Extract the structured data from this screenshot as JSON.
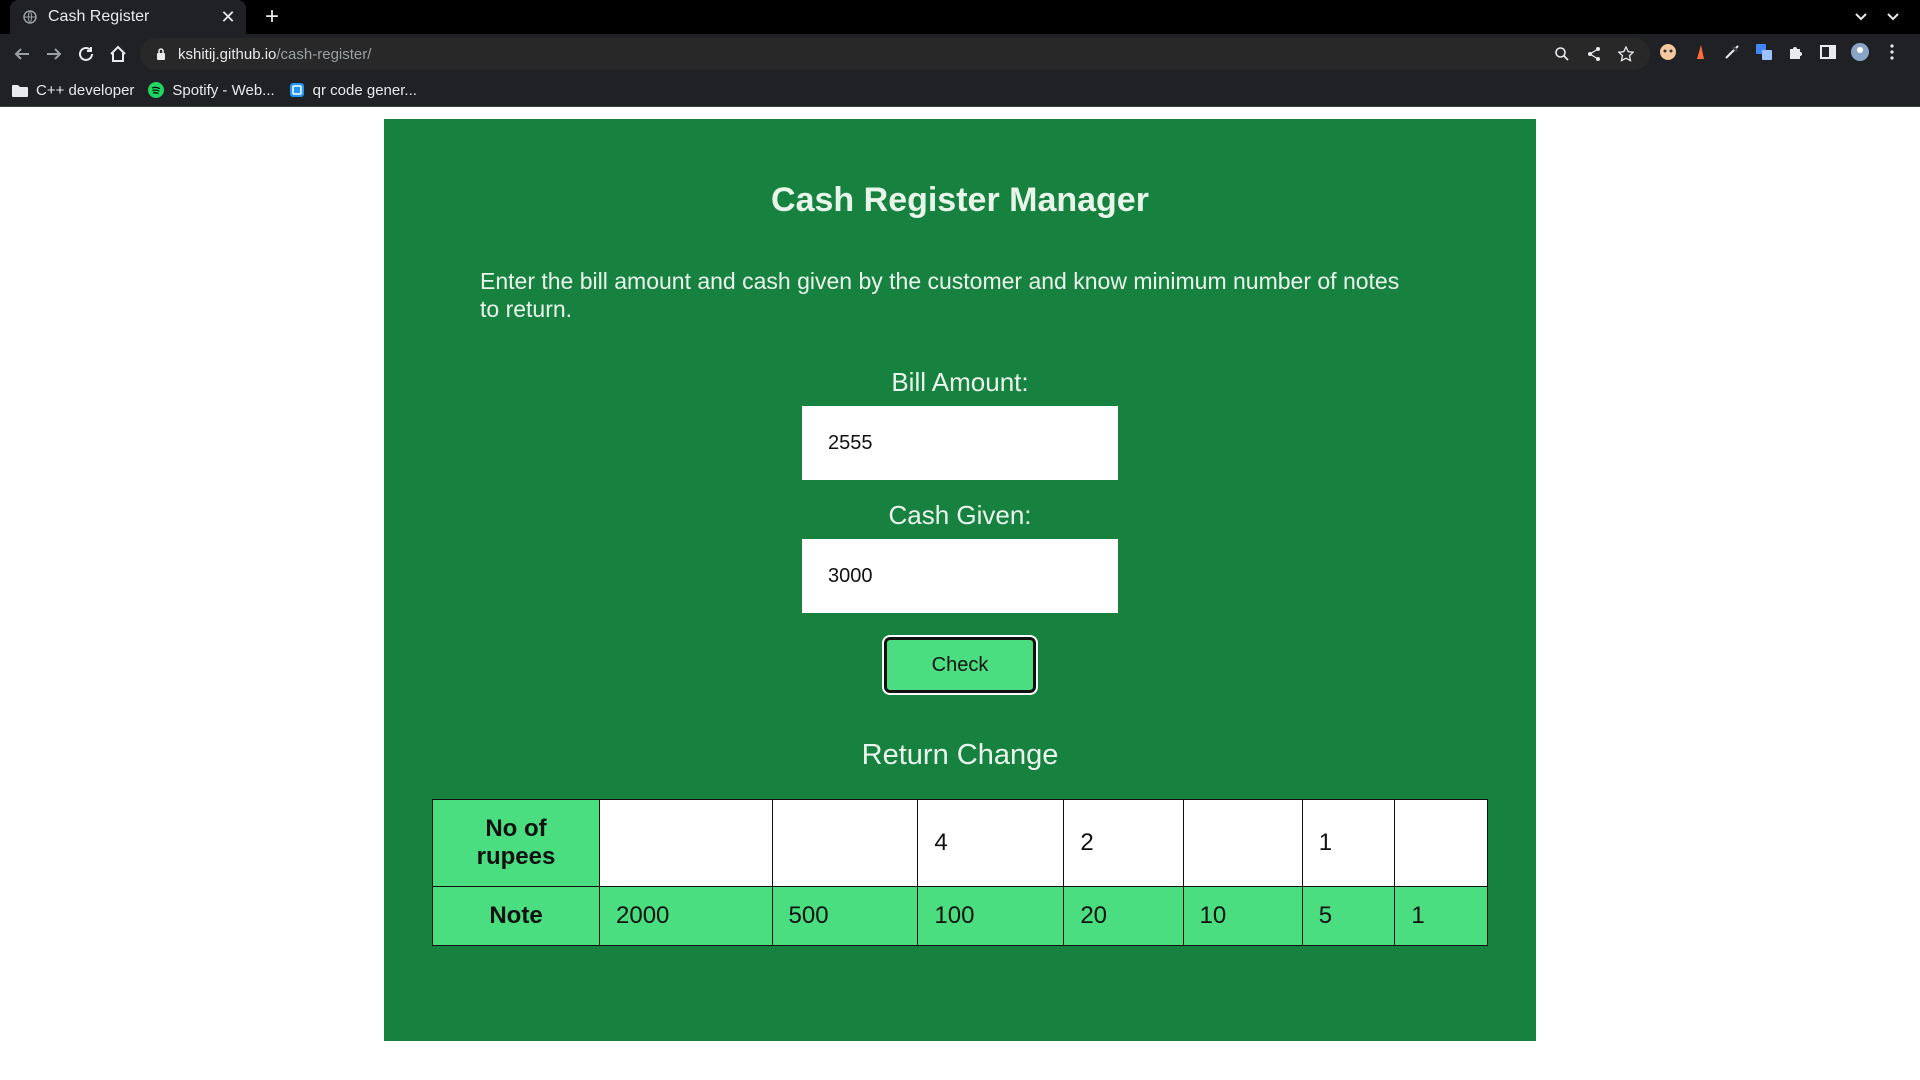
{
  "browser": {
    "tab_title": "Cash Register",
    "url_host": "kshitij.github.io",
    "url_path": "/cash-register/",
    "bookmarks": [
      {
        "label": "C++ developer",
        "icon": "folder-icon"
      },
      {
        "label": "Spotify - Web...",
        "icon": "spotify-icon"
      },
      {
        "label": "qr code gener...",
        "icon": "qr-icon"
      }
    ]
  },
  "page": {
    "heading": "Cash Register Manager",
    "description": "Enter the bill amount and cash given by the customer and know minimum number of notes to return.",
    "bill_label": "Bill Amount:",
    "bill_value": "2555",
    "cash_label": "Cash Given:",
    "cash_value": "3000",
    "check_label": "Check",
    "return_heading": "Return Change",
    "table": {
      "row1_header": "No of rupees",
      "row2_header": "Note",
      "counts": [
        "",
        "",
        "4",
        "2",
        "",
        "1",
        ""
      ],
      "notes": [
        "2000",
        "500",
        "100",
        "20",
        "10",
        "5",
        "1"
      ]
    }
  },
  "colors": {
    "panel_bg": "#178140",
    "accent_green": "#4ade80",
    "chrome_dark": "#202124"
  }
}
